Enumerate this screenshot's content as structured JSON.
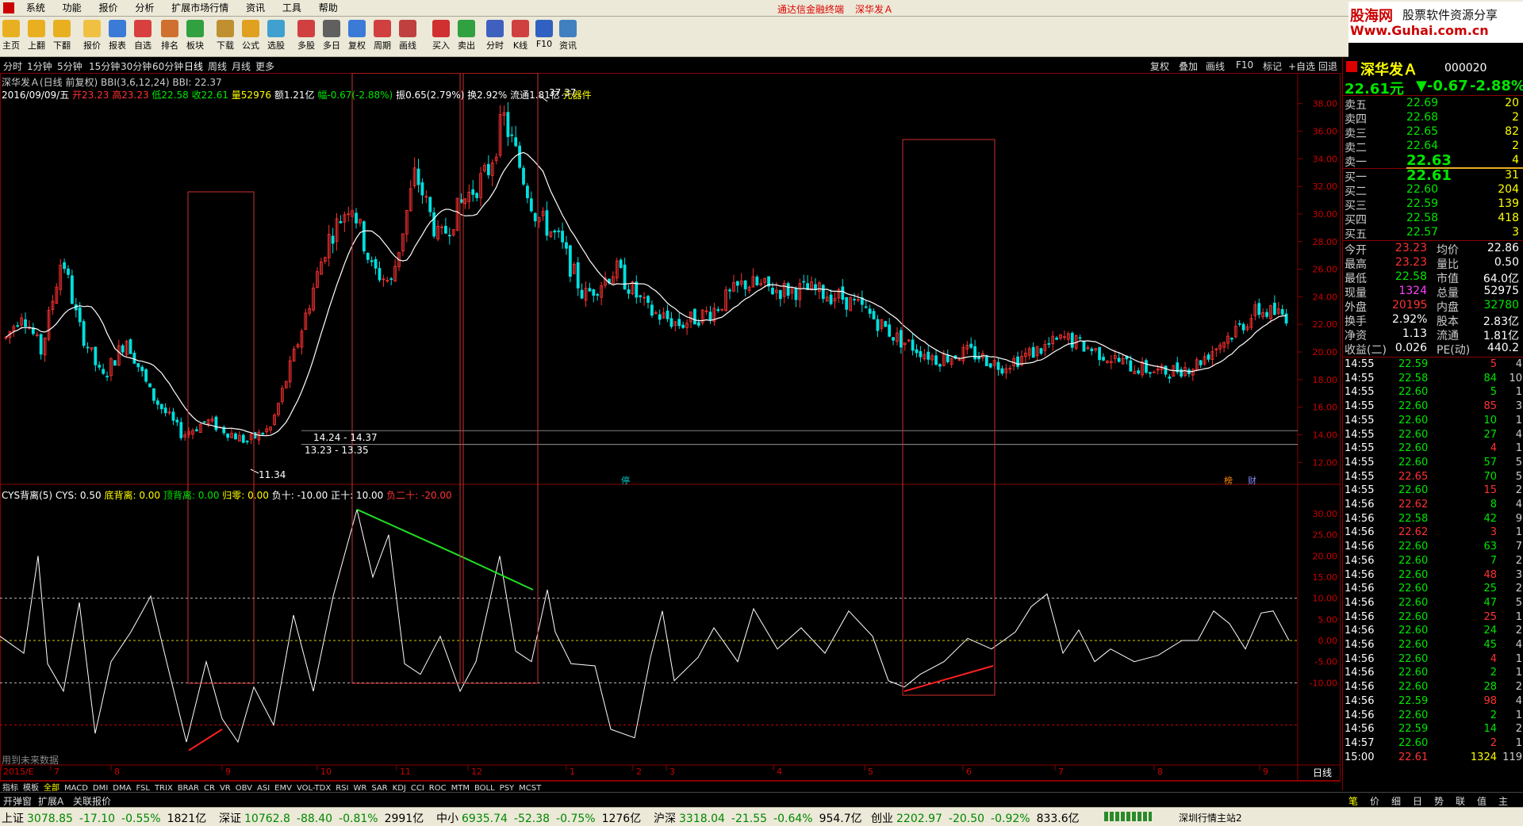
{
  "menu": {
    "items": [
      "系统",
      "功能",
      "报价",
      "分析",
      "扩展市场行情",
      "资讯",
      "工具",
      "帮助"
    ],
    "title": "通达信金融终端",
    "stock": "深华发Ａ"
  },
  "brand": {
    "name": "股海网",
    "slogan": "股票软件资源分享",
    "url": "Www.Guhai.com.cn"
  },
  "toolbar": [
    "主页",
    "上翻",
    "下翻",
    "报价",
    "报表",
    "自选",
    "排名",
    "板块",
    "下载",
    "公式",
    "选股",
    "多股",
    "多日",
    "复权",
    "周期",
    "画线",
    "买入",
    "卖出",
    "分时",
    "K线",
    "F10",
    "资讯"
  ],
  "periods": [
    "分时",
    "1分钟",
    "5分钟",
    "15分钟",
    "30分钟",
    "60分钟",
    "日线",
    "周线",
    "月线",
    "更多"
  ],
  "active_period": "日线",
  "right_buttons": [
    "复权",
    "叠加",
    "画线",
    "F10",
    "标记",
    "+自选",
    "回退"
  ],
  "main_info": {
    "line1": "深华发Ａ(日线 前复权) BBI(3,6,12,24)  BBI: 22.37",
    "date": "2016/09/09/五",
    "open": "开23.23",
    "high": "高23.23",
    "low": "低22.58",
    "close": "收22.61",
    "vol": "量52976",
    "amount": "额1.21亿",
    "change": "幅-0.67(-2.88%)",
    "amp": "振0.65(2.79%)",
    "turnover": "换2.92%",
    "float": "流通1.81亿",
    "tool": "元器件"
  },
  "annotations": {
    "max_price": "37.37",
    "min_price": "11.34",
    "range1": "14.24 - 14.37",
    "range2": "13.23 - 13.35",
    "badge_stop": "停",
    "badge_a": "榜",
    "badge_b": "财"
  },
  "ind_info": {
    "name": "CYS背离(5)",
    "cys": "CYS: 0.50",
    "bottom": "底背离: 0.00",
    "top": "顶背离: 0.00",
    "zero": "归零: 0.00",
    "neg10": "负十: -10.00",
    "pos10": "正十: 10.00",
    "neg20": "负二十: -20.00",
    "future_note": "用到未来数据"
  },
  "price_axis": [
    "38.00",
    "36.00",
    "34.00",
    "32.00",
    "30.00",
    "28.00",
    "26.00",
    "24.00",
    "22.00",
    "20.00",
    "18.00",
    "16.00",
    "14.00",
    "12.00"
  ],
  "ind_axis": [
    "30.00",
    "25.00",
    "20.00",
    "15.00",
    "10.00",
    "5.00",
    "0.00",
    "-5.00",
    "-10.00"
  ],
  "x_labels": [
    "2015/E",
    "7",
    "8",
    "9",
    "10",
    "11",
    "12",
    "1",
    "2",
    "3",
    "4",
    "5",
    "6",
    "7",
    "8",
    "9"
  ],
  "x_label_period": "日线",
  "ind_tabs": [
    "指标",
    "模板",
    "全部",
    "MACD",
    "DMI",
    "DMA",
    "FSL",
    "TRIX",
    "BRAR",
    "CR",
    "VR",
    "OBV",
    "ASI",
    "EMV",
    "VOL-TDX",
    "RSI",
    "WR",
    "SAR",
    "KDJ",
    "CCI",
    "ROC",
    "MTM",
    "BOLL",
    "PSY",
    "MCST"
  ],
  "bottom_tabs": [
    "开弹窗",
    "扩展A",
    "关联报价"
  ],
  "quote": {
    "name": "深华发Ａ",
    "code": "000020",
    "price": "22.61元",
    "change": "▼-0.67",
    "pct": "-2.88%",
    "asks": [
      {
        "label": "卖五",
        "price": "22.69",
        "vol": "20"
      },
      {
        "label": "卖四",
        "price": "22.68",
        "vol": "2"
      },
      {
        "label": "卖三",
        "price": "22.65",
        "vol": "82"
      },
      {
        "label": "卖二",
        "price": "22.64",
        "vol": "2"
      },
      {
        "label": "卖一",
        "price": "22.63",
        "vol": "4"
      }
    ],
    "bids": [
      {
        "label": "买一",
        "price": "22.61",
        "vol": "31"
      },
      {
        "label": "买二",
        "price": "22.60",
        "vol": "204"
      },
      {
        "label": "买三",
        "price": "22.59",
        "vol": "139"
      },
      {
        "label": "买四",
        "price": "22.58",
        "vol": "418"
      },
      {
        "label": "买五",
        "price": "22.57",
        "vol": "3"
      }
    ],
    "stats": [
      {
        "l1": "今开",
        "v1": "23.23",
        "l2": "均价",
        "v2": "22.86"
      },
      {
        "l1": "最高",
        "v1": "23.23",
        "l2": "量比",
        "v2": "0.50"
      },
      {
        "l1": "最低",
        "v1": "22.58",
        "l2": "市值",
        "v2": "64.0亿"
      },
      {
        "l1": "现量",
        "v1": "1324",
        "l2": "总量",
        "v2": "52975"
      },
      {
        "l1": "外盘",
        "v1": "20195",
        "l2": "内盘",
        "v2": "32780"
      },
      {
        "l1": "换手",
        "v1": "2.92%",
        "l2": "股本",
        "v2": "2.83亿"
      },
      {
        "l1": "净资",
        "v1": "1.13",
        "l2": "流通",
        "v2": "1.81亿"
      },
      {
        "l1": "收益(二)",
        "v1": "0.026",
        "l2": "PE(动)",
        "v2": "440.2"
      }
    ],
    "ticks": [
      {
        "t": "14:55",
        "p": "22.59",
        "v": "5",
        "n": "4"
      },
      {
        "t": "14:55",
        "p": "22.58",
        "v": "84",
        "n": "10"
      },
      {
        "t": "14:55",
        "p": "22.60",
        "v": "5",
        "n": "1"
      },
      {
        "t": "14:55",
        "p": "22.60",
        "v": "85",
        "n": "3"
      },
      {
        "t": "14:55",
        "p": "22.60",
        "v": "10",
        "n": "1"
      },
      {
        "t": "14:55",
        "p": "22.60",
        "v": "27",
        "n": "4"
      },
      {
        "t": "14:55",
        "p": "22.60",
        "v": "4",
        "n": "1"
      },
      {
        "t": "14:55",
        "p": "22.60",
        "v": "57",
        "n": "5"
      },
      {
        "t": "14:55",
        "p": "22.65",
        "v": "70",
        "n": "5"
      },
      {
        "t": "14:55",
        "p": "22.60",
        "v": "15",
        "n": "2"
      },
      {
        "t": "14:56",
        "p": "22.62",
        "v": "8",
        "n": "4"
      },
      {
        "t": "14:56",
        "p": "22.58",
        "v": "42",
        "n": "9"
      },
      {
        "t": "14:56",
        "p": "22.62",
        "v": "3",
        "n": "1"
      },
      {
        "t": "14:56",
        "p": "22.60",
        "v": "63",
        "n": "7"
      },
      {
        "t": "14:56",
        "p": "22.60",
        "v": "7",
        "n": "2"
      },
      {
        "t": "14:56",
        "p": "22.60",
        "v": "48",
        "n": "3"
      },
      {
        "t": "14:56",
        "p": "22.60",
        "v": "25",
        "n": "2"
      },
      {
        "t": "14:56",
        "p": "22.60",
        "v": "47",
        "n": "5"
      },
      {
        "t": "14:56",
        "p": "22.60",
        "v": "25",
        "n": "1"
      },
      {
        "t": "14:56",
        "p": "22.60",
        "v": "24",
        "n": "2"
      },
      {
        "t": "14:56",
        "p": "22.60",
        "v": "45",
        "n": "4"
      },
      {
        "t": "14:56",
        "p": "22.60",
        "v": "4",
        "n": "1"
      },
      {
        "t": "14:56",
        "p": "22.60",
        "v": "2",
        "n": "1"
      },
      {
        "t": "14:56",
        "p": "22.60",
        "v": "28",
        "n": "2"
      },
      {
        "t": "14:56",
        "p": "22.59",
        "v": "98",
        "n": "4"
      },
      {
        "t": "14:56",
        "p": "22.60",
        "v": "2",
        "n": "1"
      },
      {
        "t": "14:56",
        "p": "22.59",
        "v": "14",
        "n": "2"
      },
      {
        "t": "14:57",
        "p": "22.60",
        "v": "2",
        "n": "1"
      },
      {
        "t": "15:00",
        "p": "22.61",
        "v": "1324",
        "n": "119"
      }
    ],
    "panel_tabs": [
      "笔",
      "价",
      "细",
      "日",
      "势",
      "联",
      "值",
      "主"
    ]
  },
  "status": {
    "items": [
      {
        "name": "上证",
        "val": "3078.85",
        "chg": "-17.10",
        "pct": "-0.55%",
        "amt": "1821亿"
      },
      {
        "name": "深证",
        "val": "10762.8",
        "chg": "-88.40",
        "pct": "-0.81%",
        "amt": "2991亿"
      },
      {
        "name": "中小",
        "val": "6935.74",
        "chg": "-52.38",
        "pct": "-0.75%",
        "amt": "1276亿"
      },
      {
        "name": "沪深",
        "val": "3318.04",
        "chg": "-21.55",
        "pct": "-0.64%",
        "amt": "954.7亿"
      },
      {
        "name": "创业",
        "val": "2202.97",
        "chg": "-20.50",
        "pct": "-0.92%",
        "amt": "833.6亿"
      }
    ],
    "server": "深圳行情主站2"
  }
}
